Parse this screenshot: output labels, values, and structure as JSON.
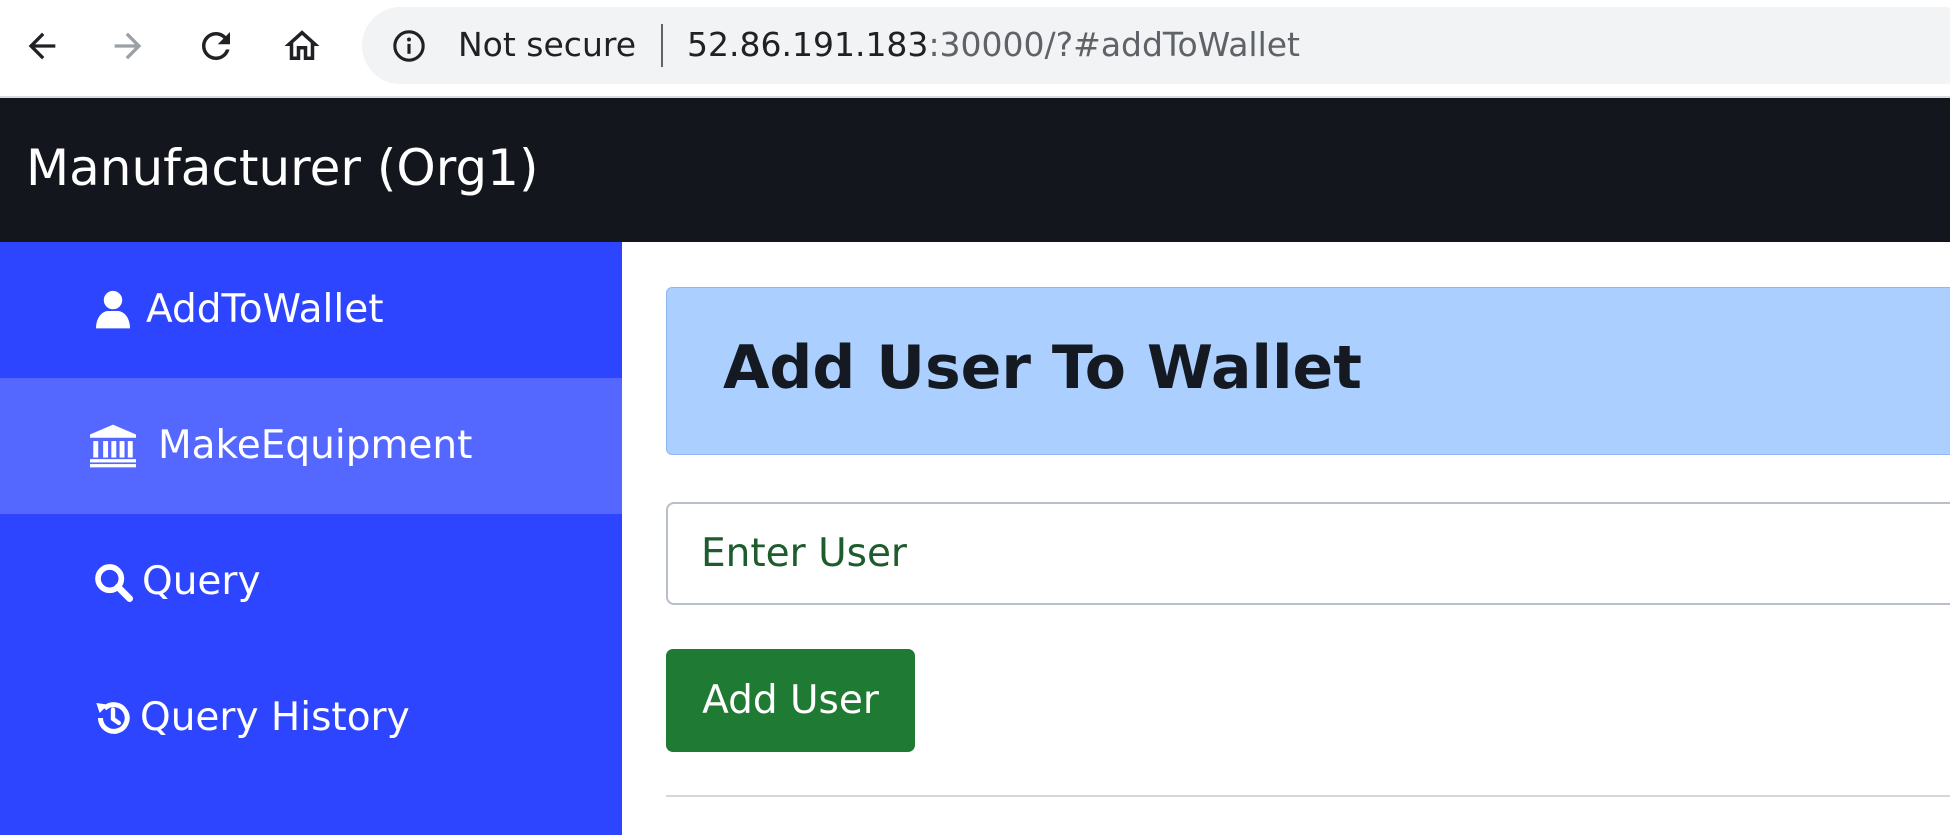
{
  "browser": {
    "security_label": "Not secure",
    "url_host": "52.86.191.183",
    "url_rest": ":30000/?#addToWallet",
    "icons": [
      "back-arrow-icon",
      "forward-arrow-icon",
      "reload-icon",
      "home-icon",
      "info-icon"
    ]
  },
  "navbar": {
    "brand": "Manufacturer (Org1)"
  },
  "sidebar": {
    "items": [
      {
        "label": "AddToWallet",
        "icon": "user-icon",
        "active": false
      },
      {
        "label": "MakeEquipment",
        "icon": "bank-icon",
        "active": true
      },
      {
        "label": "Query",
        "icon": "search-icon",
        "active": false
      },
      {
        "label": "Query History",
        "icon": "history-icon",
        "active": false
      }
    ]
  },
  "main": {
    "title": "Add User To Wallet",
    "user_input": {
      "value": "",
      "placeholder": "Enter User"
    },
    "add_button": "Add User"
  },
  "colors": {
    "navbar_bg": "#13161d",
    "sidebar_bg": "#2e45ff",
    "sidebar_active_bg": "#5468ff",
    "jumbotron_bg": "#abd0ff",
    "button_bg": "#1f7a33"
  }
}
